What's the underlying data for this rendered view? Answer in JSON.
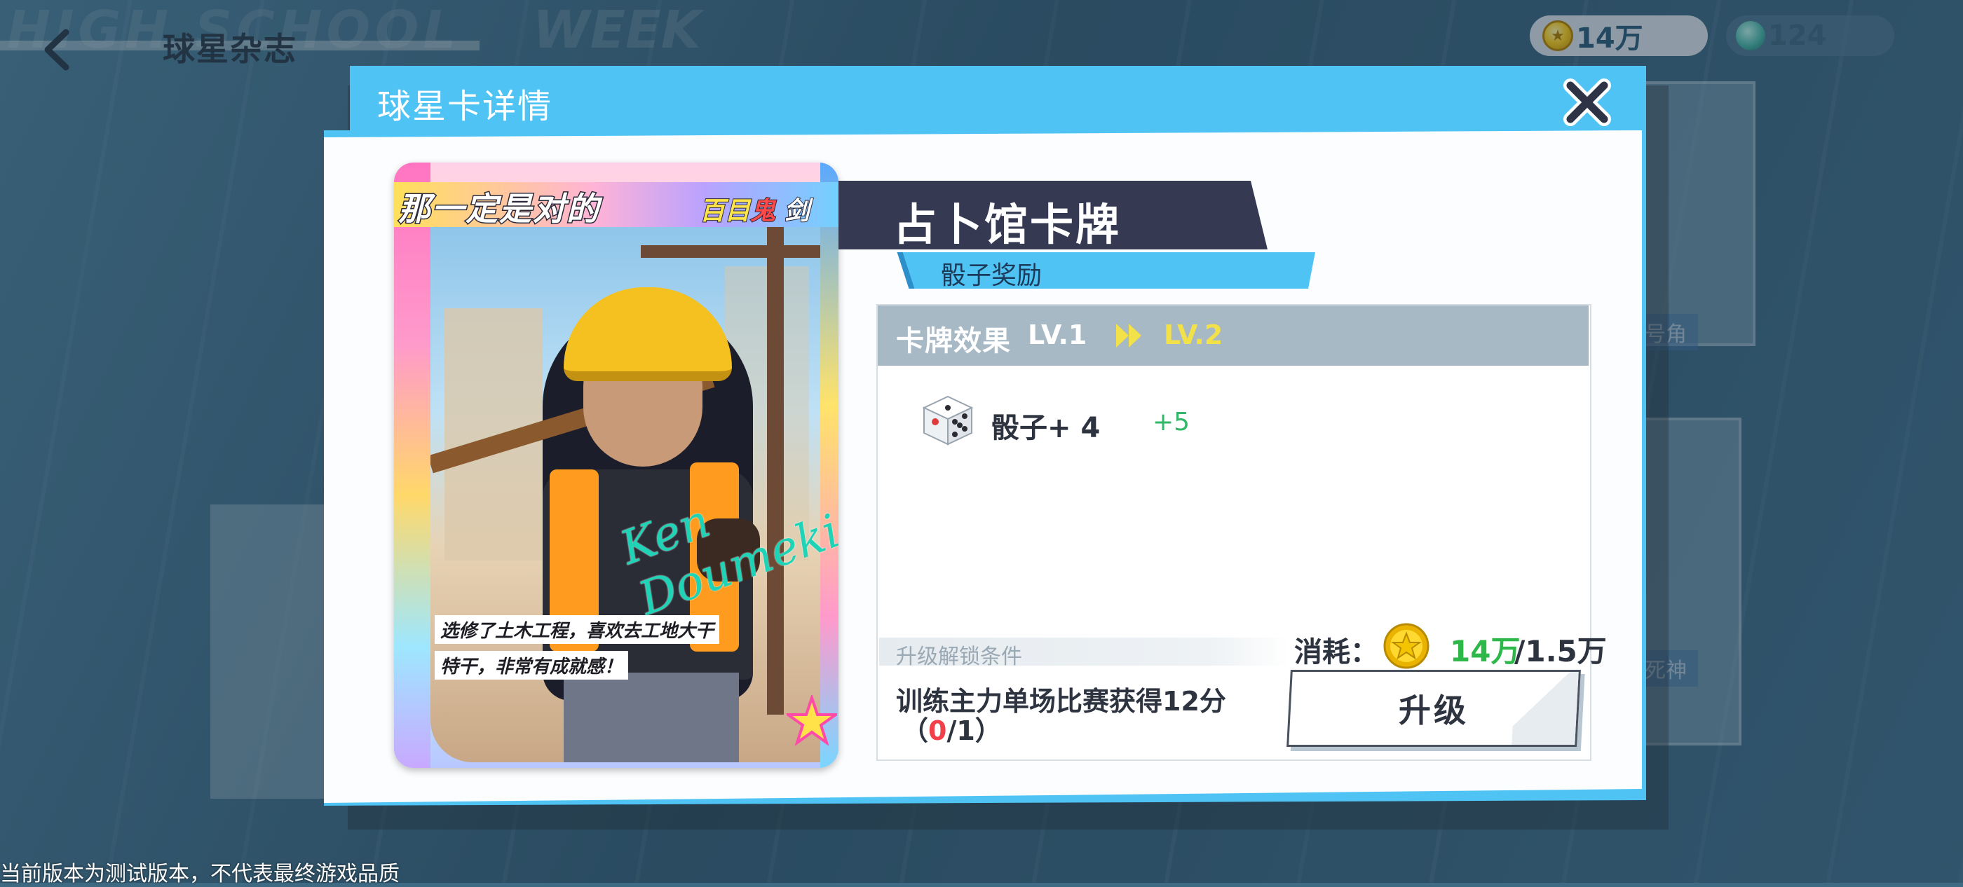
{
  "background": {
    "nav_title": "球星杂志",
    "currency": {
      "coins": "14万",
      "gems": "124"
    },
    "footer_note": "当前版本为测试版本，不代表最终游戏品质"
  },
  "dialog": {
    "title": "球星卡详情",
    "card": {
      "slogan": "那一定是对的",
      "player_name_part1": "百目",
      "player_name_part2": "鬼",
      "player_name_part3": "剑",
      "description_line1": "选修了土木工程，喜欢去工地大干",
      "description_line2": "特干，非常有成就感！",
      "signature": "Ken Doumeki"
    },
    "card_title": "占卜馆卡牌",
    "card_subtitle": "骰子奖励",
    "effect": {
      "header_label": "卡牌效果",
      "level_current": "LV.1",
      "level_next": "LV.2",
      "item_name": "骰子+ 4",
      "item_bonus": "+5"
    },
    "unlock": {
      "label": "升级解锁条件",
      "condition": "训练主力单场比赛获得12分",
      "progress_open": "（",
      "progress_current": "0",
      "progress_rest": "/1）"
    },
    "cost": {
      "label": "消耗：",
      "have": "14万",
      "need": "/1.5万"
    },
    "upgrade_button": "升级"
  },
  "colors": {
    "accent_blue": "#4fc3f4",
    "banner_dark": "#353a52",
    "effect_header": "#a8b9c6",
    "next_level_yellow": "#f3e14a",
    "positive_green": "#2fb84a",
    "warning_red": "#f2404a"
  },
  "icons": [
    "back-arrow-icon",
    "coin-icon",
    "gem-icon",
    "close-icon",
    "double-arrow-icon",
    "dice-icon",
    "star-icon"
  ]
}
